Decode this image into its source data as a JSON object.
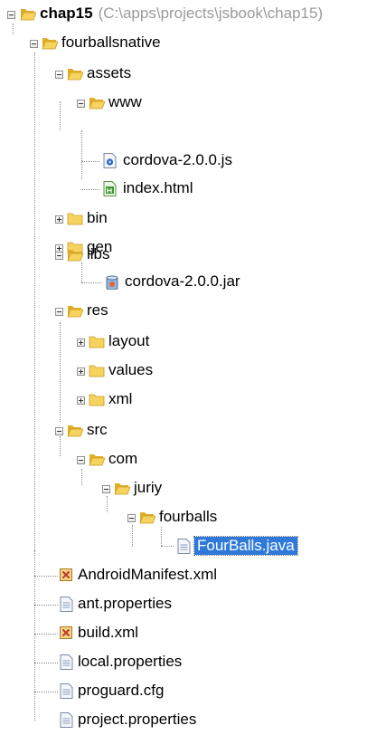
{
  "tree": {
    "root": {
      "name": "chap15",
      "path": "(C:\\apps\\projects\\jsbook\\chap15)"
    },
    "nodes": [
      {
        "name": "fourballsnative"
      },
      {
        "name": "assets"
      },
      {
        "name": "www"
      },
      {
        "name": "cordova-2.0.0.js"
      },
      {
        "name": "index.html"
      },
      {
        "name": "bin"
      },
      {
        "name": "gen"
      },
      {
        "name": "libs"
      },
      {
        "name": "cordova-2.0.0.jar"
      },
      {
        "name": "res"
      },
      {
        "name": "layout"
      },
      {
        "name": "values"
      },
      {
        "name": "xml"
      },
      {
        "name": "src"
      },
      {
        "name": "com"
      },
      {
        "name": "juriy"
      },
      {
        "name": "fourballs"
      },
      {
        "name": "FourBalls.java"
      },
      {
        "name": "AndroidManifest.xml"
      },
      {
        "name": "ant.properties"
      },
      {
        "name": "build.xml"
      },
      {
        "name": "local.properties"
      },
      {
        "name": "proguard.cfg"
      },
      {
        "name": "project.properties"
      }
    ]
  },
  "colors": {
    "selection": "#2f7ad9",
    "folder": "#f0c84a",
    "path_text": "#9a9a9a"
  }
}
